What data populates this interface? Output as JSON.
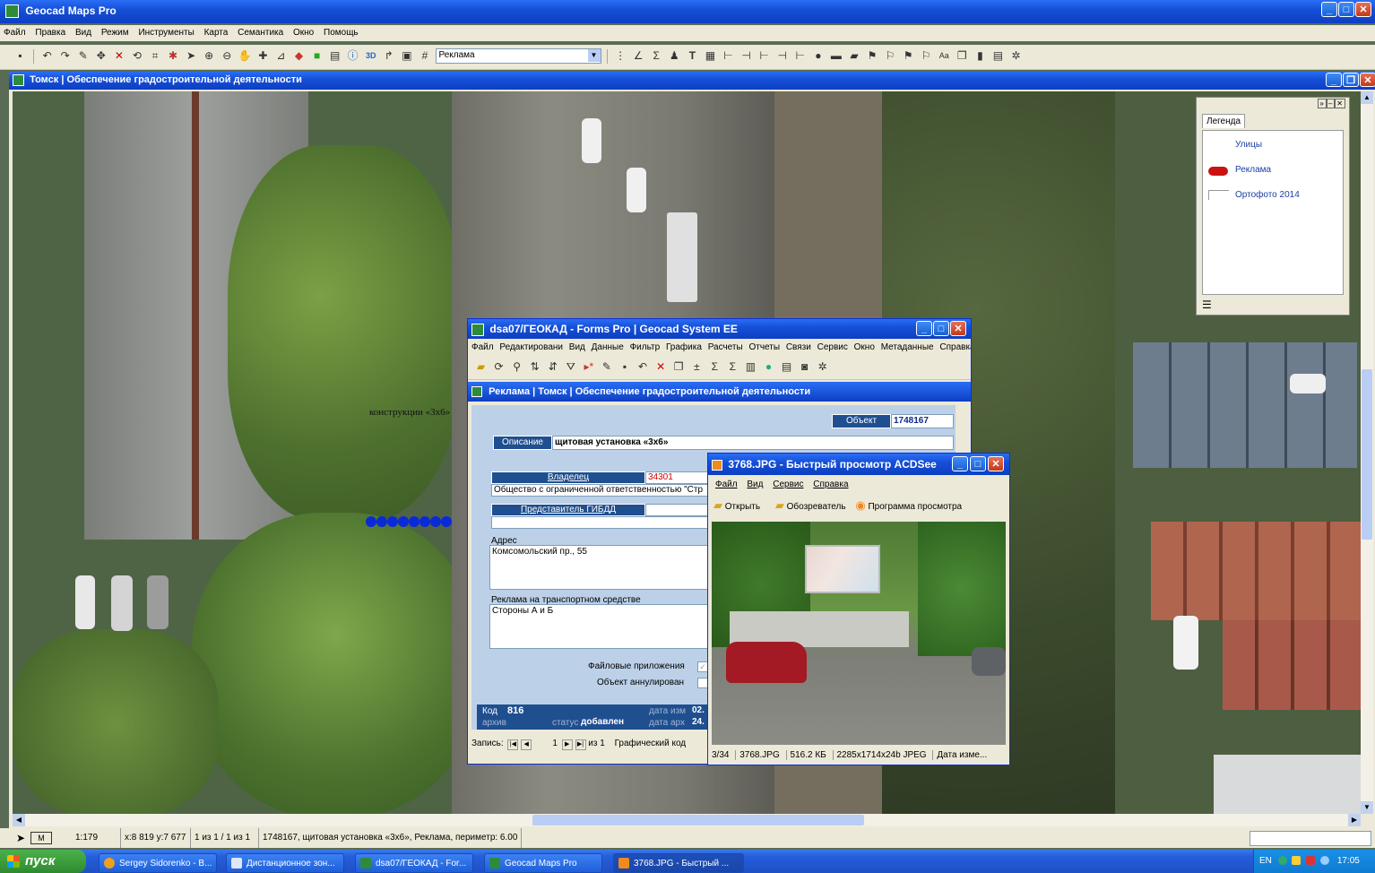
{
  "app": {
    "title": "Geocad Maps Pro"
  },
  "menu": [
    "Файл",
    "Правка",
    "Вид",
    "Режим",
    "Инструменты",
    "Карта",
    "Семантика",
    "Окно",
    "Помощь"
  ],
  "toolbar": {
    "layer_select": "Реклама"
  },
  "map_window": {
    "title": "Томск | Обеспечение градостроительной деятельности",
    "feature_label": "конструкции «3х6»"
  },
  "legend": {
    "tab": "Легенда",
    "items": [
      "Улицы",
      "Реклама",
      "Ортофото 2014"
    ]
  },
  "forms": {
    "title": "dsa07/ГЕОКАД - Forms Pro | Geocad System EE",
    "menu": [
      "Файл",
      "Редактировани",
      "Вид",
      "Данные",
      "Фильтр",
      "Графика",
      "Расчеты",
      "Отчеты",
      "Связи",
      "Сервис",
      "Окно",
      "Метаданные",
      "Справка"
    ],
    "subtitle": "Реклама | Томск | Обеспечение градостроительной деятельности",
    "object_label": "Объект",
    "object_value": "1748167",
    "desc_label": "Описание",
    "desc_value": "щитовая установка «3х6»",
    "owner_label": "Владелец",
    "owner_code": "34301",
    "owner_name": "Общество с ограниченной ответственностью \"Стр",
    "gibdd_label": "Представитель ГИБДД",
    "address_label": "Адрес",
    "address_value": "Комсомольский пр., 55",
    "transport_label": "Реклама на транспортном средстве",
    "transport_value": "Стороны А и Б",
    "files_label": "Файловые приложения",
    "annul_label": "Объект аннулирован",
    "code_label": "Код",
    "code_value": "816",
    "date_edit_label": "дата изм",
    "date_edit_value": "02.",
    "archive_label": "архив",
    "status_label": "статус",
    "status_value": "добавлен",
    "date_arch_label": "дата арх",
    "date_arch_value": "24.",
    "nav_label": "Запись:",
    "nav_current": "1",
    "nav_total": "из 1",
    "graph_code": "Графический код"
  },
  "acdsee": {
    "title": "3768.JPG - Быстрый просмотр ACDSee",
    "menu": [
      "Файл",
      "Вид",
      "Сервис",
      "Справка"
    ],
    "buttons": [
      "Открыть",
      "Обозреватель",
      "Программа просмотра"
    ],
    "status": [
      "3/34",
      "3768.JPG",
      "516.2 КБ",
      "2285x1714x24b JPEG",
      "Дата изме..."
    ]
  },
  "statusbar": {
    "mode": "М",
    "scale": "1:179",
    "coords": "x:8 819 y:7 677",
    "selection": "1 из 1 / 1 из 1",
    "info": "1748167, щитовая установка «3х6», Реклама, периметр: 6.00"
  },
  "taskbar": {
    "start": "пуск",
    "tasks": [
      "Sergey Sidorenko - В...",
      "Дистанционное зон...",
      "dsa07/ГЕОКАД - For...",
      "Geocad Maps Pro",
      "3768.JPG - Быстрый ..."
    ],
    "lang": "EN",
    "time": "17:05"
  },
  "colors": {
    "xp_blue": "#1650d8",
    "taskbar": "#245edb",
    "start_green": "#3c9a3c",
    "field_blue": "#1f4f8f"
  }
}
